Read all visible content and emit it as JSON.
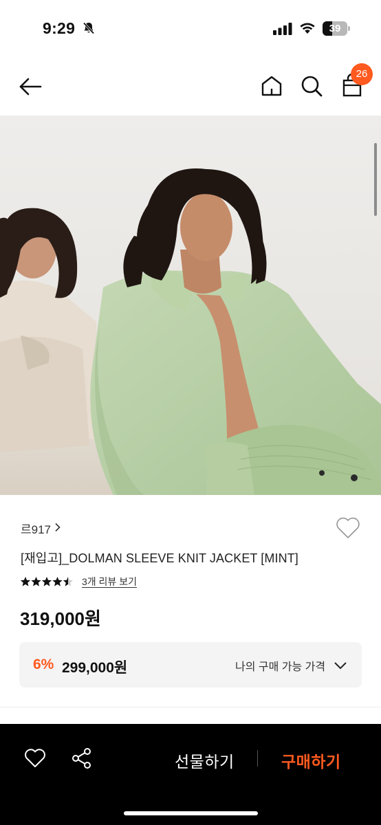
{
  "status_bar": {
    "time": "9:29",
    "battery_percent": "39",
    "battery_level": 0.39,
    "icons": [
      "bell-slash-icon",
      "signal-icon",
      "wifi-icon",
      "battery-icon"
    ]
  },
  "nav": {
    "icons": [
      "back-arrow-icon",
      "home-icon",
      "search-icon",
      "shopping-bag-icon"
    ],
    "cart_count": "26"
  },
  "product": {
    "brand": "르917",
    "title": "[재입고]_DOLMAN SLEEVE KNIT JACKET [MINT]",
    "rating_stars": 4.5,
    "review_link": "3개 리뷰 보기",
    "price": "319,000",
    "price_unit": "원",
    "discount": {
      "rate": "6%",
      "price": "299,000원",
      "my_price_label": "나의 구매 가능 가격"
    }
  },
  "bottom_bar": {
    "gift_label": "선물하기",
    "buy_label": "구매하기",
    "icons": [
      "heart-icon",
      "share-icon"
    ]
  },
  "colors": {
    "accent": "#ff5a1f",
    "mint_knit": "#b9d0a8",
    "bottom_bar_bg": "#000000"
  }
}
